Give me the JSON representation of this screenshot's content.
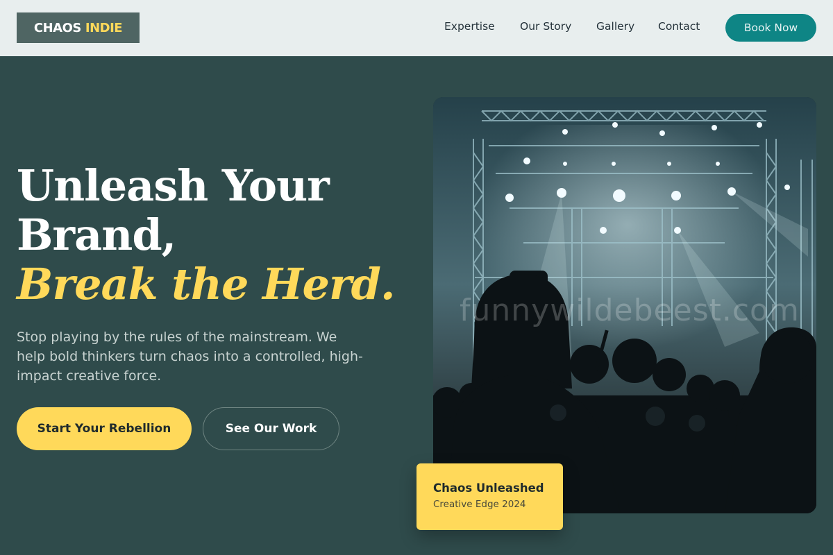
{
  "brand": {
    "word1": "CHAOS",
    "word2": "INDIE"
  },
  "nav": {
    "links": [
      "Expertise",
      "Our Story",
      "Gallery",
      "Contact"
    ],
    "cta": "Book Now"
  },
  "hero": {
    "title_line1": "Unleash Your",
    "title_line2": "Brand,",
    "title_accent": "Break the Herd.",
    "description": "Stop playing by the rules of the mainstream. We help bold thinkers turn chaos into a controlled, high-impact creative force.",
    "primary_button": "Start Your Rebellion",
    "secondary_button": "See Our Work"
  },
  "image": {
    "watermark": "funnywildebeest.com"
  },
  "badge": {
    "title": "Chaos Unleashed",
    "subtitle": "Creative Edge 2024"
  },
  "colors": {
    "accent": "#ffd95a",
    "teal": "#0e8585",
    "bg": "#2f4b4b",
    "nav_bg": "#e8eeee"
  },
  "icons": []
}
